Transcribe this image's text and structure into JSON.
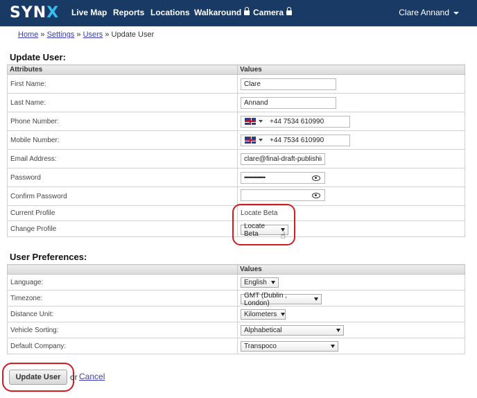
{
  "nav": {
    "logo": "SYN",
    "logo_x": "X",
    "items": [
      {
        "label": "Live Map"
      },
      {
        "label": "Reports"
      },
      {
        "label": "Locations"
      },
      {
        "label": "Walkaround"
      },
      {
        "label": "Camera"
      }
    ],
    "user": "Clare Annand"
  },
  "breadcrumb": {
    "home": "Home",
    "sep1": " » ",
    "settings": "Settings",
    "sep2": " » ",
    "users": "Users",
    "sep3": " » ",
    "current": "Update User"
  },
  "update_user": {
    "title": "Update User:",
    "col_attributes": "Attributes",
    "col_values": "Values",
    "first_name_label": "First Name:",
    "first_name_value": "Clare",
    "last_name_label": "Last Name:",
    "last_name_value": "Annand",
    "phone_label": "Phone Number:",
    "phone_value": "+44 7534 610990",
    "mobile_label": "Mobile Number:",
    "mobile_value": "+44 7534 610990",
    "email_label": "Email Address:",
    "email_value": "clare@final-draft-publishing",
    "password_label": "Password",
    "password_mask": "••••••••••••••",
    "confirm_password_label": "Confirm Password",
    "current_profile_label": "Current Profile",
    "current_profile_value": "Locate Beta",
    "change_profile_label": "Change Profile",
    "change_profile_value": "Locate Beta"
  },
  "preferences": {
    "title": "User Preferences:",
    "col_values": "Values",
    "language_label": "Language:",
    "language_value": "English",
    "timezone_label": "Timezone:",
    "timezone_value": "GMT (Dublin , London)",
    "distance_label": "Distance Unit:",
    "distance_value": "Kilometers",
    "sorting_label": "Vehicle Sorting:",
    "sorting_value": "Alphabetical",
    "company_label": "Default Company:",
    "company_value": "Transpoco"
  },
  "actions": {
    "update_button": "Update User",
    "or": "or",
    "cancel": "Cancel"
  },
  "colors": {
    "navbar": "#1a3a66",
    "logo_accent": "#35c0ef",
    "highlight": "#d4191f",
    "link": "#3b3bb3"
  }
}
